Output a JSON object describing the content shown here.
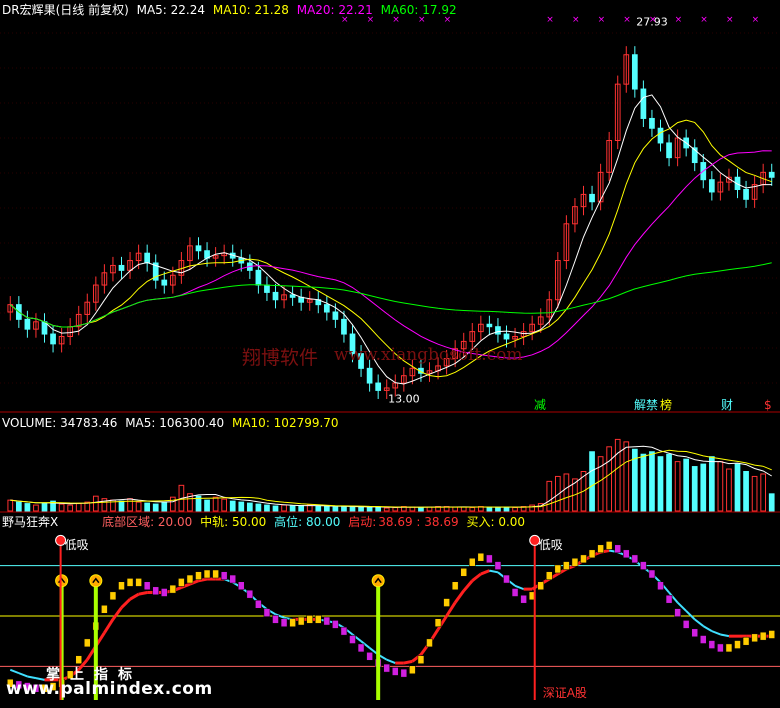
{
  "main_legend": {
    "title": "DR宏辉果(日线 前复权)",
    "ma5": "MA5: 22.24",
    "ma10": "MA10: 21.28",
    "ma20": "MA20: 22.21",
    "ma60": "MA60: 17.92"
  },
  "volume_legend": {
    "vol": "VOLUME: 34783.46",
    "ma5": "MA5: 106300.40",
    "ma10": "MA10: 102799.70"
  },
  "indicator_legend": {
    "name": "野马狂奔X",
    "bottom": "底部区域: 20.00",
    "mid": "中轨: 50.00",
    "high": "高位: 80.00",
    "start_label": "启动:",
    "start_val": "38.69 : 38.69",
    "buy": "买入: 0.00"
  },
  "annotations": {
    "high_price": "27.93",
    "low_price": "13.00",
    "dixi_1": "低吸",
    "dixi_2": "低吸",
    "market_label": "深证A股",
    "event_tags": [
      "减",
      "解禁",
      "榜",
      "财",
      "$"
    ]
  },
  "watermarks": {
    "cn": "翔博软件",
    "url_cn": "www.xiangbosoft.com",
    "url_bottom": "www.palmindex.com",
    "caption": "掌上指标"
  },
  "colors": {
    "bg": "#000000",
    "up": "#ff3232",
    "down": "#54ffff",
    "ma5": "#ffffff",
    "ma10": "#ffff00",
    "ma20": "#ff00ff",
    "ma60": "#00ff00"
  },
  "chart_data": [
    {
      "type": "candlestick",
      "title": "DR宏辉果(日线 前复权)",
      "series": [
        {
          "name": "MA5",
          "last": 22.24
        },
        {
          "name": "MA10",
          "last": 21.28
        },
        {
          "name": "MA20",
          "last": 22.21
        },
        {
          "name": "MA60",
          "last": 17.92
        }
      ],
      "annotations": [
        {
          "label": "27.93",
          "kind": "high"
        },
        {
          "label": "13.00",
          "kind": "low"
        }
      ],
      "close": [
        16.8,
        16.2,
        15.8,
        16.1,
        15.6,
        15.2,
        15.5,
        15.9,
        16.4,
        16.9,
        17.6,
        18.1,
        18.4,
        18.2,
        18.6,
        18.9,
        18.5,
        17.8,
        17.6,
        18.0,
        18.6,
        19.2,
        19.0,
        18.7,
        18.8,
        18.9,
        18.7,
        18.5,
        18.2,
        17.6,
        17.3,
        17.0,
        17.2,
        17.1,
        16.9,
        17.0,
        16.8,
        16.5,
        16.2,
        15.6,
        14.8,
        14.2,
        13.6,
        13.3,
        13.4,
        13.6,
        13.9,
        14.2,
        14.0,
        14.1,
        14.3,
        14.6,
        15.0,
        15.3,
        15.7,
        16.0,
        15.9,
        15.6,
        15.4,
        15.5,
        15.7,
        16.0,
        16.3,
        17.0,
        18.6,
        20.1,
        20.8,
        21.3,
        21.0,
        22.2,
        23.5,
        25.8,
        27.0,
        25.6,
        24.4,
        24.0,
        23.4,
        22.8,
        23.6,
        23.2,
        22.6,
        21.9,
        21.4,
        21.8,
        22.0,
        21.5,
        21.1,
        21.7,
        22.2,
        22.0
      ],
      "ylim": [
        12.5,
        28.5
      ]
    },
    {
      "type": "bar",
      "title": "VOLUME",
      "series": [
        {
          "name": "VOLUME",
          "last": 34783.46
        },
        {
          "name": "MA5",
          "last": 106300.4
        },
        {
          "name": "MA10",
          "last": 102799.7
        }
      ],
      "values": [
        22000,
        18000,
        15000,
        12000,
        16000,
        20000,
        14000,
        12000,
        15000,
        18000,
        30000,
        25000,
        22000,
        20000,
        25000,
        18000,
        16000,
        14000,
        18000,
        28000,
        52000,
        35000,
        30000,
        22000,
        28000,
        24000,
        20000,
        18000,
        16000,
        14000,
        12000,
        10000,
        12000,
        10000,
        11000,
        12000,
        10000,
        9000,
        8000,
        9000,
        10000,
        8000,
        7000,
        8000,
        6000,
        7000,
        9000,
        8000,
        7000,
        8000,
        9000,
        9000,
        8000,
        8000,
        7000,
        9000,
        8000,
        7000,
        8000,
        7000,
        9000,
        12000,
        15000,
        60000,
        70000,
        75000,
        65000,
        80000,
        120000,
        110000,
        130000,
        145000,
        140000,
        125000,
        115000,
        120000,
        110000,
        115000,
        100000,
        105000,
        90000,
        95000,
        110000,
        100000,
        85000,
        95000,
        80000,
        70000,
        75000,
        34783.46
      ],
      "ylim": [
        0,
        160000
      ]
    },
    {
      "type": "line",
      "title": "野马狂奔X",
      "reference_lines": {
        "底部区域": 20,
        "中轨": 50,
        "高位": 80
      },
      "series": [
        {
          "name": "启动",
          "last": 38.69
        },
        {
          "name": "买入",
          "last": 0.0
        }
      ],
      "fast": [
        10,
        9,
        8,
        7,
        7,
        8,
        10,
        15,
        24,
        34,
        44,
        54,
        62,
        68,
        70,
        70,
        68,
        65,
        64,
        66,
        70,
        72,
        74,
        75,
        75,
        74,
        72,
        68,
        63,
        57,
        52,
        48,
        46,
        46,
        47,
        48,
        48,
        47,
        45,
        41,
        36,
        31,
        26,
        22,
        19,
        17,
        16,
        18,
        24,
        34,
        46,
        58,
        68,
        76,
        82,
        85,
        84,
        80,
        72,
        64,
        60,
        62,
        68,
        74,
        78,
        80,
        82,
        84,
        87,
        90,
        92,
        90,
        87,
        84,
        80,
        75,
        68,
        60,
        52,
        45,
        40,
        36,
        33,
        31,
        31,
        33,
        35,
        37,
        38,
        39
      ],
      "slow": [
        18,
        16,
        14,
        13,
        12,
        12,
        12,
        14,
        18,
        24,
        32,
        40,
        48,
        55,
        60,
        63,
        64,
        64,
        64,
        65,
        67,
        69,
        71,
        72,
        72,
        72,
        70,
        67,
        63,
        58,
        54,
        51,
        49,
        48,
        48,
        48,
        48,
        47,
        46,
        43,
        39,
        35,
        31,
        27,
        24,
        22,
        22,
        23,
        27,
        34,
        42,
        50,
        58,
        65,
        71,
        75,
        77,
        76,
        72,
        68,
        66,
        66,
        69,
        72,
        75,
        78,
        80,
        83,
        86,
        88,
        89,
        88,
        86,
        83,
        79,
        75,
        70,
        64,
        58,
        53,
        48,
        44,
        41,
        39,
        38,
        38,
        38,
        38,
        38,
        38
      ],
      "ylim": [
        0,
        100
      ]
    }
  ]
}
